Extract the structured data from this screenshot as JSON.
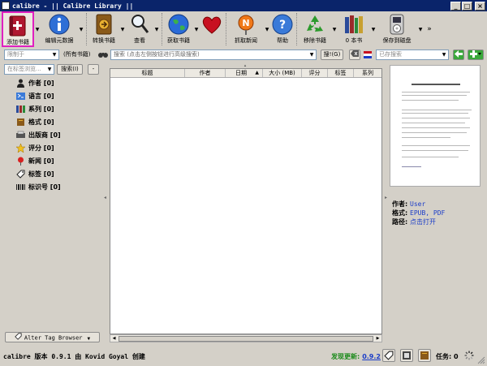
{
  "window": {
    "title": "calibre - || Calibre Library ||",
    "minimize": "_",
    "maximize": "□",
    "close": "×"
  },
  "toolbar": {
    "items": [
      {
        "label": "添加书籍",
        "icon": "add-book-icon"
      },
      {
        "label": "编辑元数据",
        "icon": "info-icon"
      },
      {
        "label": "转换书籍",
        "icon": "convert-icon"
      },
      {
        "label": "查看",
        "icon": "magnifier-icon"
      },
      {
        "label": "获取书籍",
        "icon": "globe-icon"
      },
      {
        "label": "",
        "icon": "heart-icon"
      },
      {
        "label": "抓取新闻",
        "icon": "news-icon"
      },
      {
        "label": "帮助",
        "icon": "help-icon"
      },
      {
        "label": "移除书籍",
        "icon": "recycle-icon"
      },
      {
        "label": "0 本书",
        "icon": "library-icon"
      },
      {
        "label": "保存到磁盘",
        "icon": "ipod-icon"
      }
    ],
    "more": "»"
  },
  "searchbar": {
    "restrict_label": "限制于",
    "all_books": "(所有书籍)",
    "search_placeholder": "搜索 (点击左侧按钮进行高级搜索)",
    "search_button": "搜!(G)",
    "saved_search_placeholder": "已存搜索"
  },
  "tag_browser": {
    "search_placeholder": "在标签浏览...",
    "search_button": "搜索(I)",
    "collapse_button": "-",
    "items": [
      {
        "label": "作者 [0]",
        "icon": "person-icon"
      },
      {
        "label": "语言 [0]",
        "icon": "language-icon"
      },
      {
        "label": "系列 [0]",
        "icon": "series-icon"
      },
      {
        "label": "格式 [0]",
        "icon": "book-format-icon"
      },
      {
        "label": "出版商 [0]",
        "icon": "publisher-icon"
      },
      {
        "label": "评分 [0]",
        "icon": "star-icon"
      },
      {
        "label": "新闻 [0]",
        "icon": "news-pin-icon"
      },
      {
        "label": "标签 [0]",
        "icon": "tag-icon"
      },
      {
        "label": "标识号 [0]",
        "icon": "barcode-icon"
      }
    ],
    "alter_button": "Alter Tag Browser"
  },
  "booklist": {
    "columns": [
      "标题",
      "作者",
      "日期",
      "大小 (MB)",
      "评分",
      "标签",
      "系列"
    ],
    "sort_indicator": "▲"
  },
  "details": {
    "author_label": "作者:",
    "author_value": "User",
    "format_label": "格式:",
    "format_value": "EPUB, PDF",
    "path_label": "路径:",
    "path_value": "点击打开"
  },
  "statusbar": {
    "version_text": "calibre 版本 0.9.1 由 Kovid Goyal 创建",
    "update_label": "发现更新:",
    "update_version": "0.9.2",
    "jobs_label": "任务: 0"
  }
}
